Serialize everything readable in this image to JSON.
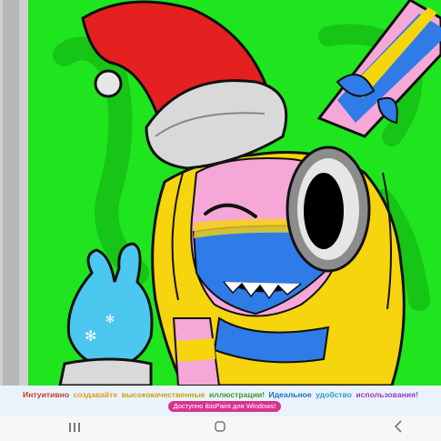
{
  "promo": {
    "segments": [
      {
        "text": "Интуитивно",
        "color": "#c63a2b"
      },
      {
        "text": "создавайте",
        "color": "#e39b17"
      },
      {
        "text": "высококачественные",
        "color": "#c5a20f"
      },
      {
        "text": "иллюстрации!",
        "color": "#3b9a2f"
      },
      {
        "text": "Идеальное",
        "color": "#1d6fcf"
      },
      {
        "text": "удобство",
        "color": "#2a9fd4"
      },
      {
        "text": "использования!",
        "color": "#9b3bc2"
      }
    ],
    "button_label": "Доступно ibisPaint для Windows!"
  },
  "navbar": {
    "recents_icon": "recents-icon",
    "home_icon": "home-icon",
    "back_icon": "back-icon"
  },
  "colors": {
    "background_green": "#1ee51e",
    "hat_red": "#e52020",
    "hair_yellow": "#f6d40e",
    "face_pink": "#f5a7d8",
    "face_blue": "#2f7be8",
    "glove_cyan": "#4cc7f0"
  }
}
